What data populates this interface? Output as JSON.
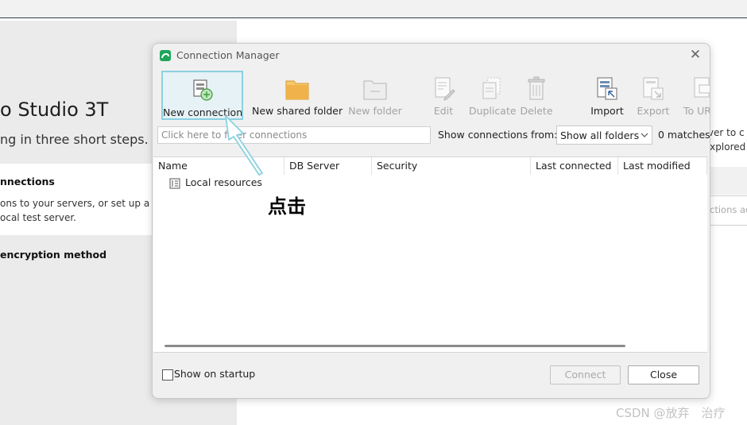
{
  "background": {
    "title": "o Studio 3T",
    "subtitle": "ng in three short steps.",
    "step1_heading": "nnections",
    "step1_line1": "ons to your servers, or set up a",
    "step1_line2": "ocal test server.",
    "step2_heading": " encryption method",
    "right_line1": "rver to c",
    "right_line2": "explored",
    "right_faded": "ctions ac"
  },
  "dialog": {
    "title": "Connection Manager",
    "toolbar": {
      "new_connection": "New connection",
      "new_shared_folder": "New shared folder",
      "new_folder": "New folder",
      "edit": "Edit",
      "duplicate": "Duplicate",
      "delete": "Delete",
      "import": "Import",
      "export": "Export",
      "to_uri": "To URI"
    },
    "filter_placeholder": "Click here to filter connections",
    "show_from_label": "Show connections from:",
    "show_from_value": "Show all folders",
    "matches": "0 matches",
    "columns": {
      "name": "Name",
      "db_server": "DB Server",
      "security": "Security",
      "last_connected": "Last connected",
      "last_modified": "Last modified"
    },
    "rows": [
      {
        "name": "Local resources"
      }
    ],
    "show_on_startup": "Show on startup",
    "connect_button": "Connect",
    "close_button": "Close"
  },
  "annotation": {
    "text": "点击"
  },
  "watermark": "CSDN @放弃　治疗",
  "colors": {
    "accent_green": "#1fa65a",
    "highlight_border": "#8ad1e0",
    "folder_orange": "#f0b24a"
  }
}
